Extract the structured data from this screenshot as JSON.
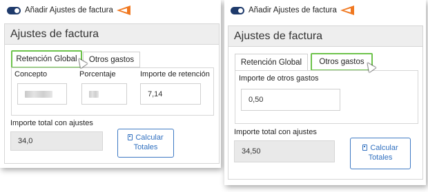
{
  "left": {
    "toggle_label": "Añadir Ajustes de factura",
    "panel_title": "Ajustes de factura",
    "tabs": [
      {
        "label": "Retención Global",
        "highlighted": true
      },
      {
        "label": "Otros gastos",
        "highlighted": false
      }
    ],
    "fields": {
      "concepto_label": "Concepto",
      "porcentaje_label": "Porcentaje",
      "importe_retencion_label": "Importe de retención",
      "importe_retencion_value": "7,14"
    },
    "total_label": "Importe total con ajustes",
    "total_value": "34,0",
    "calc_button_line1": "Calcular",
    "calc_button_line2": "Totales"
  },
  "right": {
    "toggle_label": "Añadir Ajustes de factura",
    "panel_title": "Ajustes de factura",
    "tabs": [
      {
        "label": "Retención Global",
        "highlighted": false
      },
      {
        "label": "Otros gastos",
        "highlighted": true
      }
    ],
    "fields": {
      "importe_otros_gastos_label": "Importe de otros gastos",
      "importe_otros_gastos_value": "0,50"
    },
    "total_label": "Importe total con ajustes",
    "total_value": "34,50",
    "calc_button_line1": "Calcular",
    "calc_button_line2": "Totales"
  },
  "colors": {
    "toggle": "#1e3a6b",
    "highlight": "#6cc24a",
    "arrow": "#f07820",
    "button": "#2f6fbf"
  },
  "icons": [
    "toggle-switch-icon",
    "arrow-pointer-icon",
    "calculator-icon",
    "mouse-cursor-icon"
  ]
}
